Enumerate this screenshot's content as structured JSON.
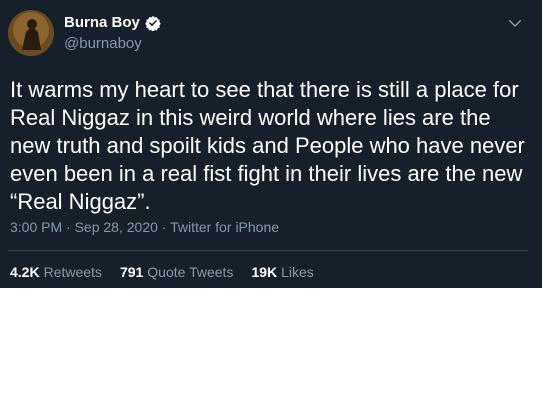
{
  "tweet": {
    "author_name": "Burna Boy",
    "handle": "@burnaboy",
    "text": "It warms my heart to see that there is still a place for Real Niggaz in this weird world where lies are the new truth and spoilt kids and People who have never even been in a real fist fight in their lives are the new “Real Niggaz”.",
    "time": "3:00 PM",
    "date": "Sep 28, 2020",
    "source": "Twitter for iPhone",
    "sep": " · "
  },
  "stats": {
    "retweets_count": "4.2K",
    "retweets_label": "Retweets",
    "quotes_count": "791",
    "quotes_label": "Quote Tweets",
    "likes_count": "19K",
    "likes_label": "Likes"
  },
  "colors": {
    "background": "#15202b",
    "text": "#ffffff",
    "muted": "#8899a6",
    "verified": "#1da1f2",
    "divider": "#38444d"
  },
  "icons": {
    "verified": "verified-badge-icon",
    "menu": "chevron-down-icon"
  }
}
